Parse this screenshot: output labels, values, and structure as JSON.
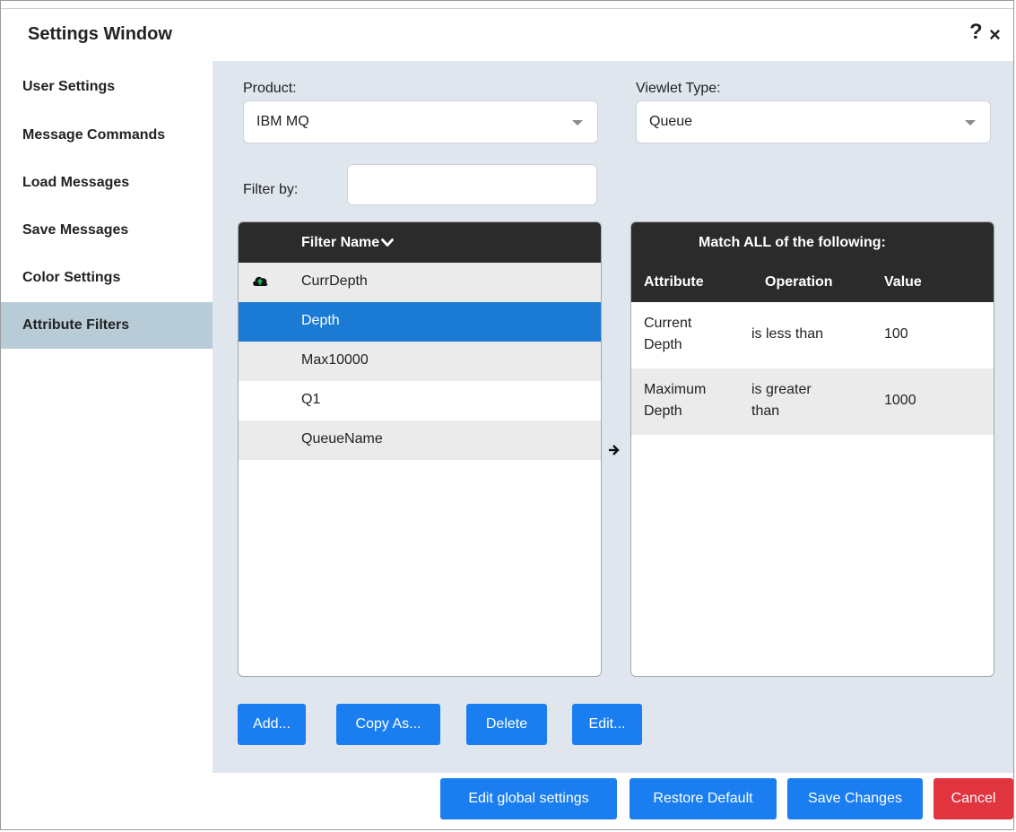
{
  "window": {
    "title": "Settings Window",
    "help_label": "?",
    "close_label": "×"
  },
  "sidebar": {
    "items": [
      {
        "label": "User Settings"
      },
      {
        "label": "Message Commands"
      },
      {
        "label": "Load Messages"
      },
      {
        "label": "Save Messages"
      },
      {
        "label": "Color Settings"
      },
      {
        "label": "Attribute Filters"
      }
    ],
    "active": "Attribute Filters"
  },
  "form": {
    "product_label": "Product:",
    "product_value": "IBM MQ",
    "viewlet_label": "Viewlet Type:",
    "viewlet_value": "Queue",
    "filter_label": "Filter by:",
    "filter_value": ""
  },
  "filter_list": {
    "header": "Filter Name",
    "sort_icon": "chevron-down-icon",
    "rows": [
      {
        "name": "CurrDepth",
        "icon": "cloud-upload-icon"
      },
      {
        "name": "Depth"
      },
      {
        "name": "Max10000"
      },
      {
        "name": "Q1"
      },
      {
        "name": "QueueName"
      }
    ],
    "selected": "Depth"
  },
  "conditions": {
    "title": "Match ALL of the following:",
    "columns": [
      "Attribute",
      "Operation",
      "Value"
    ],
    "rows": [
      {
        "attribute": [
          "Current",
          "Depth"
        ],
        "operation": [
          "is less than"
        ],
        "value": "100"
      },
      {
        "attribute": [
          "Maximum",
          "Depth"
        ],
        "operation": [
          "is greater",
          "than"
        ],
        "value": "1000"
      }
    ]
  },
  "actions": {
    "add": "Add...",
    "copy_as": "Copy As...",
    "delete": "Delete",
    "edit": "Edit..."
  },
  "footer": {
    "edit_global": "Edit global settings",
    "restore_default": "Restore Default",
    "save_changes": "Save Changes",
    "cancel": "Cancel"
  },
  "colors": {
    "accent": "#1a7ef0",
    "selected_row": "#1a7ad4",
    "cancel": "#e0343f",
    "header_dark": "#2b2b2b",
    "sidebar_active": "#b8ccd8",
    "content_bg": "#dfe6ee"
  }
}
